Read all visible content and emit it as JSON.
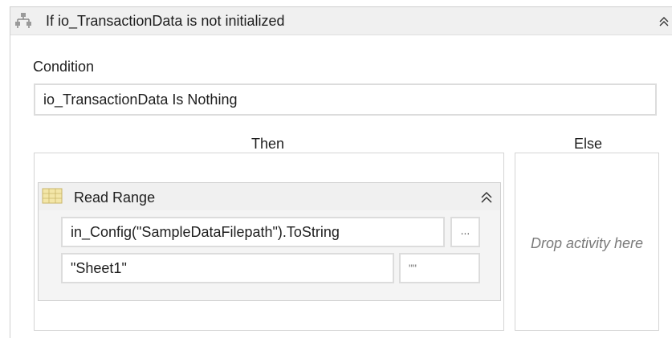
{
  "if_activity": {
    "icon": "if-branch-icon",
    "title": "If io_TransactionData is not initialized",
    "collapse_icon": "chevron-double-up-icon"
  },
  "condition": {
    "label": "Condition",
    "value": "io_TransactionData Is Nothing"
  },
  "then": {
    "label": "Then"
  },
  "else": {
    "label": "Else",
    "drop_hint": "Drop activity here"
  },
  "read_range": {
    "icon": "excel-read-range-icon",
    "title": "Read Range",
    "collapse_icon": "chevron-double-up-icon",
    "path_value": "in_Config(\"SampleDataFilepath\").ToString",
    "browse_label": "...",
    "sheet_value": "\"Sheet1\"",
    "range_value": "\"\""
  },
  "colors": {
    "header_bg": "#f0f0f0",
    "border": "#dcdcdc",
    "hint_text": "#7a7a7a"
  }
}
